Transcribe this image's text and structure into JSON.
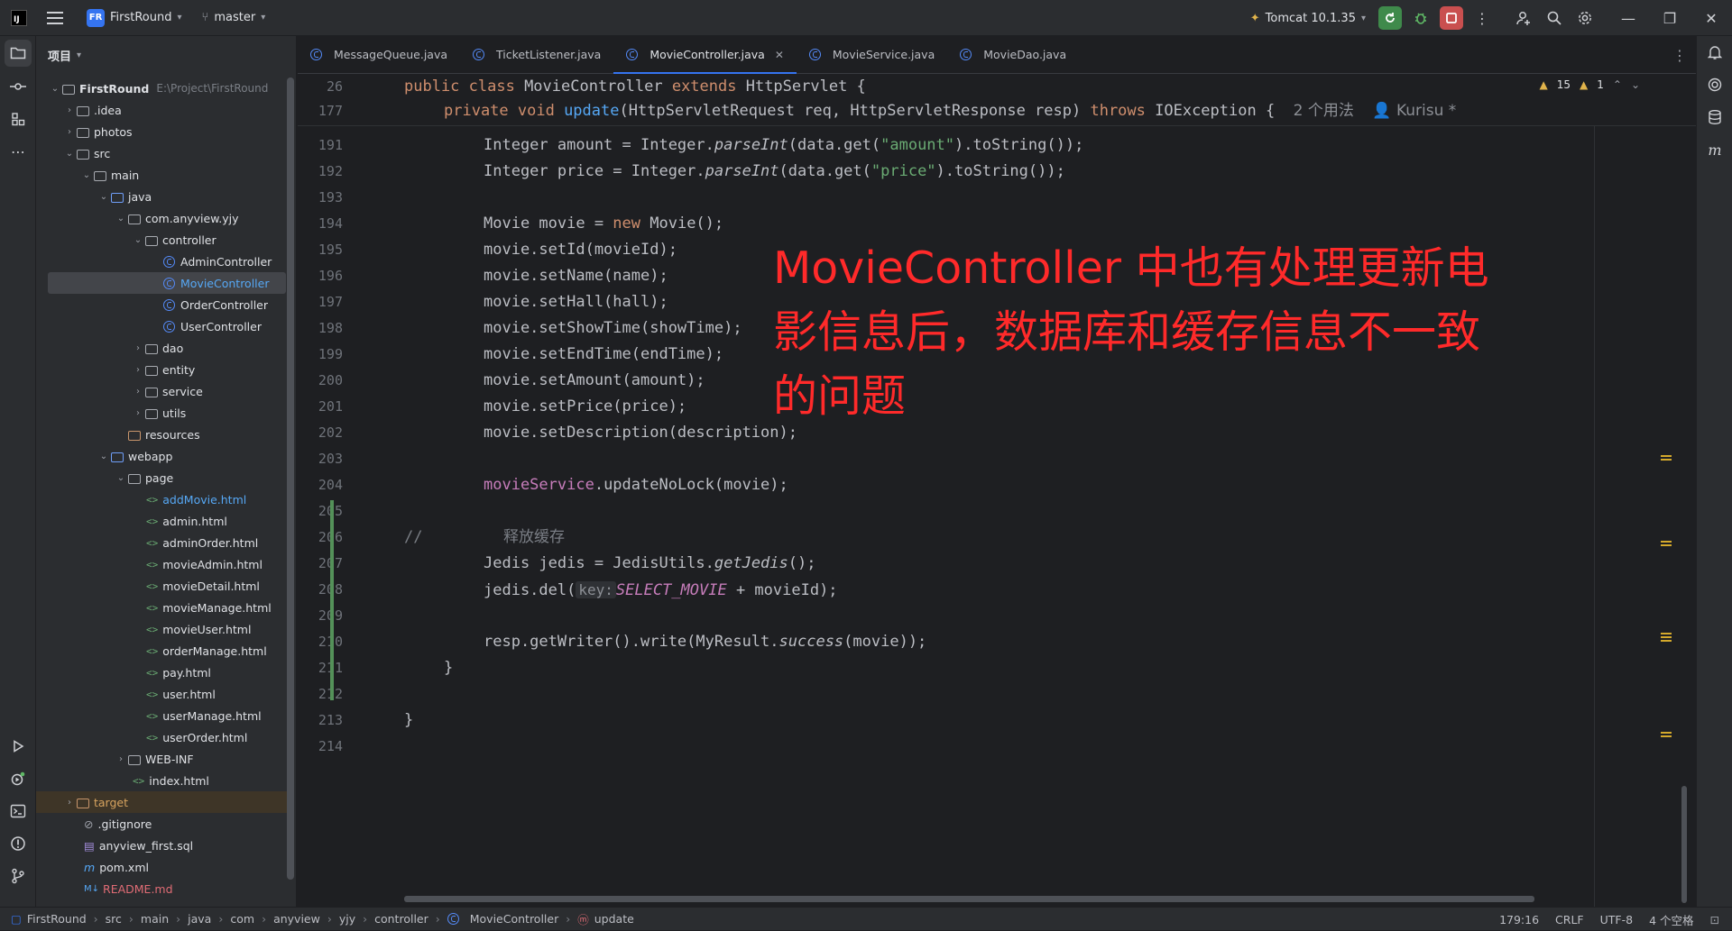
{
  "titlebar": {
    "project_initials": "FR",
    "project_name": "FirstRound",
    "branch": "master",
    "run_config": "Tomcat 10.1.35"
  },
  "project_panel": {
    "title": "项目",
    "root_name": "FirstRound",
    "root_path": "E:\\Project\\FirstRound",
    "items": [
      {
        "label": ".idea"
      },
      {
        "label": "photos"
      },
      {
        "label": "src"
      },
      {
        "label": "main"
      },
      {
        "label": "java"
      },
      {
        "label": "com.anyview.yjy"
      },
      {
        "label": "controller"
      },
      {
        "label": "AdminController"
      },
      {
        "label": "MovieController"
      },
      {
        "label": "OrderController"
      },
      {
        "label": "UserController"
      },
      {
        "label": "dao"
      },
      {
        "label": "entity"
      },
      {
        "label": "service"
      },
      {
        "label": "utils"
      },
      {
        "label": "resources"
      },
      {
        "label": "webapp"
      },
      {
        "label": "page"
      },
      {
        "label": "addMovie.html"
      },
      {
        "label": "admin.html"
      },
      {
        "label": "adminOrder.html"
      },
      {
        "label": "movieAdmin.html"
      },
      {
        "label": "movieDetail.html"
      },
      {
        "label": "movieManage.html"
      },
      {
        "label": "movieUser.html"
      },
      {
        "label": "orderManage.html"
      },
      {
        "label": "pay.html"
      },
      {
        "label": "user.html"
      },
      {
        "label": "userManage.html"
      },
      {
        "label": "userOrder.html"
      },
      {
        "label": "WEB-INF"
      },
      {
        "label": "index.html"
      },
      {
        "label": "target"
      },
      {
        "label": ".gitignore"
      },
      {
        "label": "anyview_first.sql"
      },
      {
        "label": "pom.xml"
      },
      {
        "label": "README.md"
      }
    ]
  },
  "tabs": [
    {
      "label": "MessageQueue.java"
    },
    {
      "label": "TicketListener.java"
    },
    {
      "label": "MovieController.java"
    },
    {
      "label": "MovieService.java"
    },
    {
      "label": "MovieDao.java"
    }
  ],
  "inspections": {
    "warnings": "15",
    "weak_warnings": "1"
  },
  "editor": {
    "sticky": [
      {
        "num": "26",
        "text": "public class MovieController extends HttpServlet {"
      },
      {
        "num": "177",
        "text": "private void update(HttpServletRequest req, HttpServletResponse resp) throws IOException {",
        "usages": "2 个用法",
        "author": "Kurisu *"
      }
    ],
    "line_numbers": [
      "191",
      "192",
      "193",
      "194",
      "195",
      "196",
      "197",
      "198",
      "199",
      "200",
      "201",
      "202",
      "203",
      "204",
      "205",
      "206",
      "207",
      "208",
      "209",
      "210",
      "211",
      "212",
      "213",
      "214"
    ],
    "comment_text": "释放缓存",
    "hint_key": "key:"
  },
  "annotation": "MovieController 中也有处理更新电影信息后，数据库和缓存信息不一致的问题",
  "statusbar": {
    "breadcrumbs": [
      "FirstRound",
      "src",
      "main",
      "java",
      "com",
      "anyview",
      "yjy",
      "controller",
      "MovieController",
      "update"
    ],
    "position": "179:16",
    "line_sep": "CRLF",
    "encoding": "UTF-8",
    "indent": "4 个空格"
  }
}
